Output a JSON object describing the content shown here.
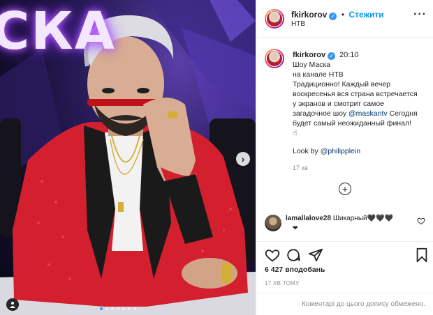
{
  "post": {
    "username": "fkirkorov",
    "follow_label": "Стежити",
    "location": "НТВ",
    "caption_time": "20:10",
    "caption_lines": [
      "Шоу Маска",
      "на канале НТВ",
      "Традиционно! Каждый вечер",
      "воскресенья вся страна встречается",
      "у экранов и смотрит самое",
      "загадочное шоу"
    ],
    "caption_mention": "@maskantv",
    "caption_after_mention": " Сегодня",
    "caption_tail_1": "будет самый неожиданный финал!",
    "caption_tail_2": "☝",
    "look_by_label": "Look by ",
    "look_by_mention": "@philipplein",
    "age": "17 хв",
    "likes": "6 427 вподобань",
    "date": "17 ХВ ТОМУ",
    "restricted_text": "Коментарі до цього допису обмежено."
  },
  "photo": {
    "sign_text": "СКА",
    "carousel_dot_count": 7,
    "active_dot": 0
  },
  "comment": {
    "username": "lamallalove28",
    "text": " Шикарный🖤🖤🖤",
    "second_line": "❤"
  },
  "colors": {
    "accent": "#0095f6",
    "verified": "#3897f0",
    "mention": "#00376b",
    "muted": "#8e8e8e",
    "jacket": "#d4202e"
  },
  "icons": [
    "verified-icon",
    "more-icon",
    "chevron-right-icon",
    "user-tag-icon",
    "plus-circle-icon",
    "heart-icon",
    "comment-icon",
    "share-icon",
    "bookmark-icon"
  ]
}
